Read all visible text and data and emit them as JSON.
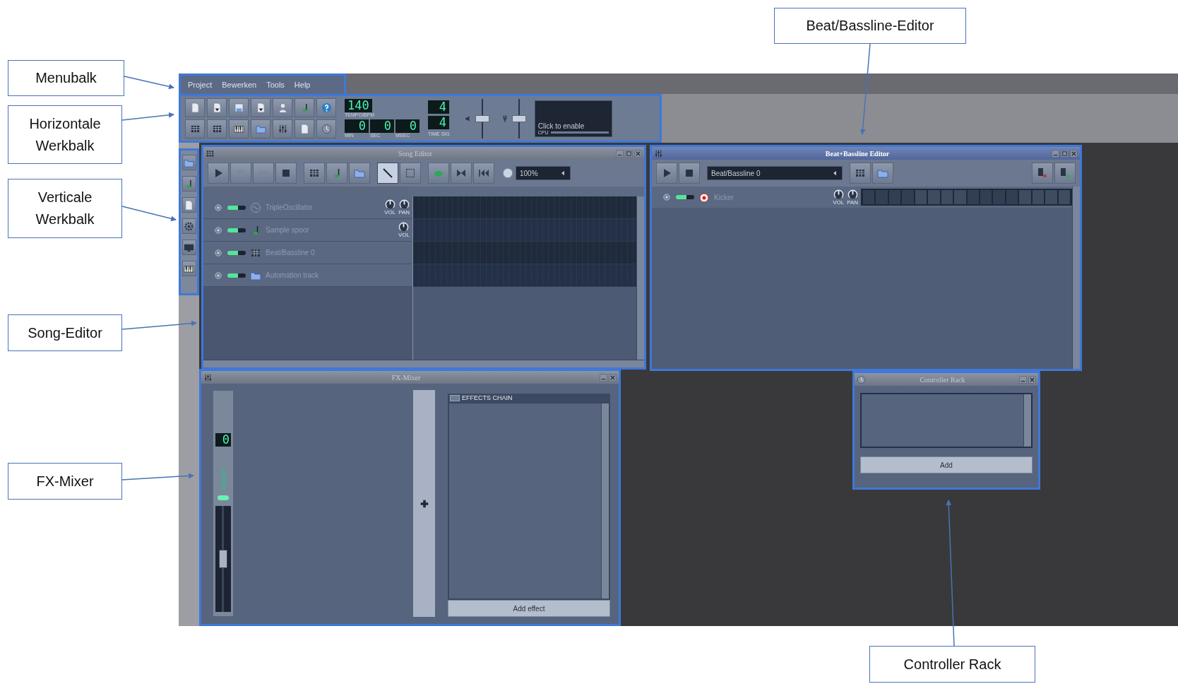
{
  "callouts": [
    {
      "text": "Menubalk"
    },
    {
      "text": "Horizontale Werkbalk"
    },
    {
      "text": "Verticale Werkbalk"
    },
    {
      "text": "Song-Editor"
    },
    {
      "text": "FX-Mixer"
    },
    {
      "text": "Beat/Bassline-Editor"
    },
    {
      "text": "Controller Rack"
    }
  ],
  "menu": [
    {
      "label": "Project"
    },
    {
      "label": "Bewerken"
    },
    {
      "label": "Tools"
    },
    {
      "label": "Help"
    }
  ],
  "toolbar": {
    "tempo": {
      "value": "140",
      "label": "TEMPO/BPM"
    },
    "time": [
      {
        "value": "0",
        "label": "MIN"
      },
      {
        "value": "0",
        "label": "SEC"
      },
      {
        "value": "0",
        "label": "MSEC"
      }
    ],
    "time_signature": {
      "numerator": "4",
      "denominator": "4",
      "label": "TIME SIG"
    },
    "sliders": [
      {
        "level": 0.5
      },
      {
        "level": 0.5
      }
    ],
    "cpu": {
      "text": "Click to enable",
      "label": "CPU"
    }
  },
  "song_editor": {
    "title": "Song Editor",
    "active": false,
    "tools": [
      {
        "selected": true
      },
      {
        "selected": false
      }
    ],
    "zoom": "100%",
    "tracks": [
      {
        "kind": "synth",
        "name": "TripleOscillator",
        "knobs": [
          "VOL",
          "PAN"
        ]
      },
      {
        "kind": "sample",
        "name": "Sample spoor",
        "knobs": [
          "VOL"
        ]
      },
      {
        "kind": "beat",
        "name": "Beat/Bassline 0"
      },
      {
        "kind": "automation",
        "name": "Automation track"
      }
    ]
  },
  "beat_bassline_editor": {
    "title": "Beat+Bassline Editor",
    "active": true,
    "pattern": "Beat/Bassline 0",
    "tracks": [
      {
        "kind": "drum",
        "name": "Kicker",
        "knobs": [
          "VOL",
          "PAN"
        ]
      }
    ]
  },
  "fx_mixer": {
    "title": "FX-Mixer",
    "active": false,
    "master": {
      "number": "0",
      "name": "Master",
      "level": 0.5
    },
    "effects": {
      "enabled": true,
      "title": "EFFECTS CHAIN",
      "button": "Add effect"
    }
  },
  "controller_rack": {
    "title": "Controller Rack",
    "active": false,
    "button": "Add"
  }
}
